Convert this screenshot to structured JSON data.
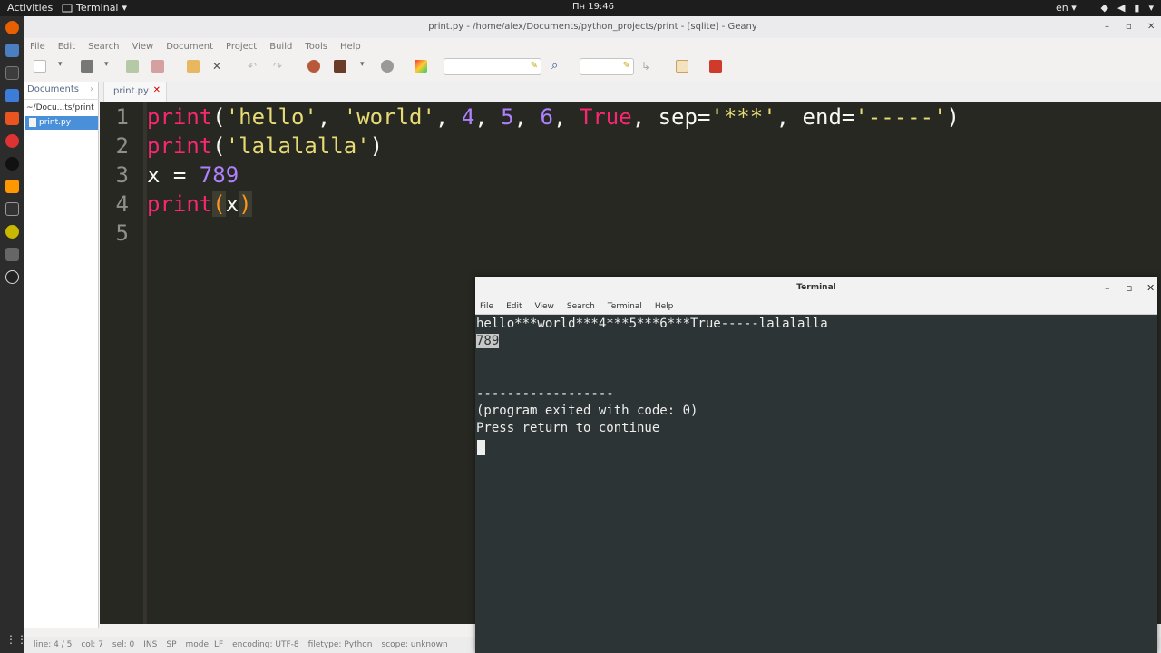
{
  "top_panel": {
    "activities": "Activities",
    "app_name": "Terminal",
    "clock": "Пн 19:46",
    "language": "en"
  },
  "geany": {
    "title": "print.py - /home/alex/Documents/python_projects/print - [sqlite] - Geany",
    "menu": [
      "File",
      "Edit",
      "Search",
      "View",
      "Document",
      "Project",
      "Build",
      "Tools",
      "Help"
    ],
    "sidebar": {
      "tab_label": "Documents",
      "folder": "~/Docu...ts/print",
      "file": "print.py"
    },
    "editor_tab": "print.py",
    "line_numbers": [
      "1",
      "2",
      "3",
      "4",
      "5"
    ],
    "code": {
      "l1": {
        "fn": "print",
        "open": "(",
        "s1": "'hello'",
        "c1": ", ",
        "s2": "'world'",
        "c2": ", ",
        "n1": "4",
        "c3": ", ",
        "n2": "5",
        "c4": ", ",
        "n3": "6",
        "c5": ", ",
        "kw": "True",
        "c6": ", sep=",
        "s3": "'***'",
        "c7": ", end=",
        "s4": "'-----'",
        "close": ")"
      },
      "l2": {
        "fn": "print",
        "open": "(",
        "s1": "'lalalalla'",
        "close": ")"
      },
      "l3": {
        "lhs": "x = ",
        "num": "789"
      },
      "l4": {
        "fn": "print",
        "open": "(",
        "arg": "x",
        "close": ")"
      }
    },
    "status": {
      "line": "line: 4 / 5",
      "col": "col: 7",
      "sel": "sel: 0",
      "ins": "INS",
      "sp": "SP",
      "mode": "mode: LF",
      "encoding": "encoding: UTF-8",
      "filetype": "filetype: Python",
      "scope": "scope: unknown"
    }
  },
  "terminal": {
    "title": "Terminal",
    "menu": [
      "File",
      "Edit",
      "View",
      "Search",
      "Terminal",
      "Help"
    ],
    "output": {
      "line1": "hello***world***4***5***6***True-----lalalalla",
      "line2": "789",
      "line3": "------------------",
      "line4": "(program exited with code: 0)",
      "line5": "Press return to continue"
    }
  },
  "colors": {
    "editor_bg": "#272822",
    "keyword": "#f92672",
    "string": "#e6db74",
    "number": "#ae81ff",
    "terminal_bg": "#2d3435"
  }
}
